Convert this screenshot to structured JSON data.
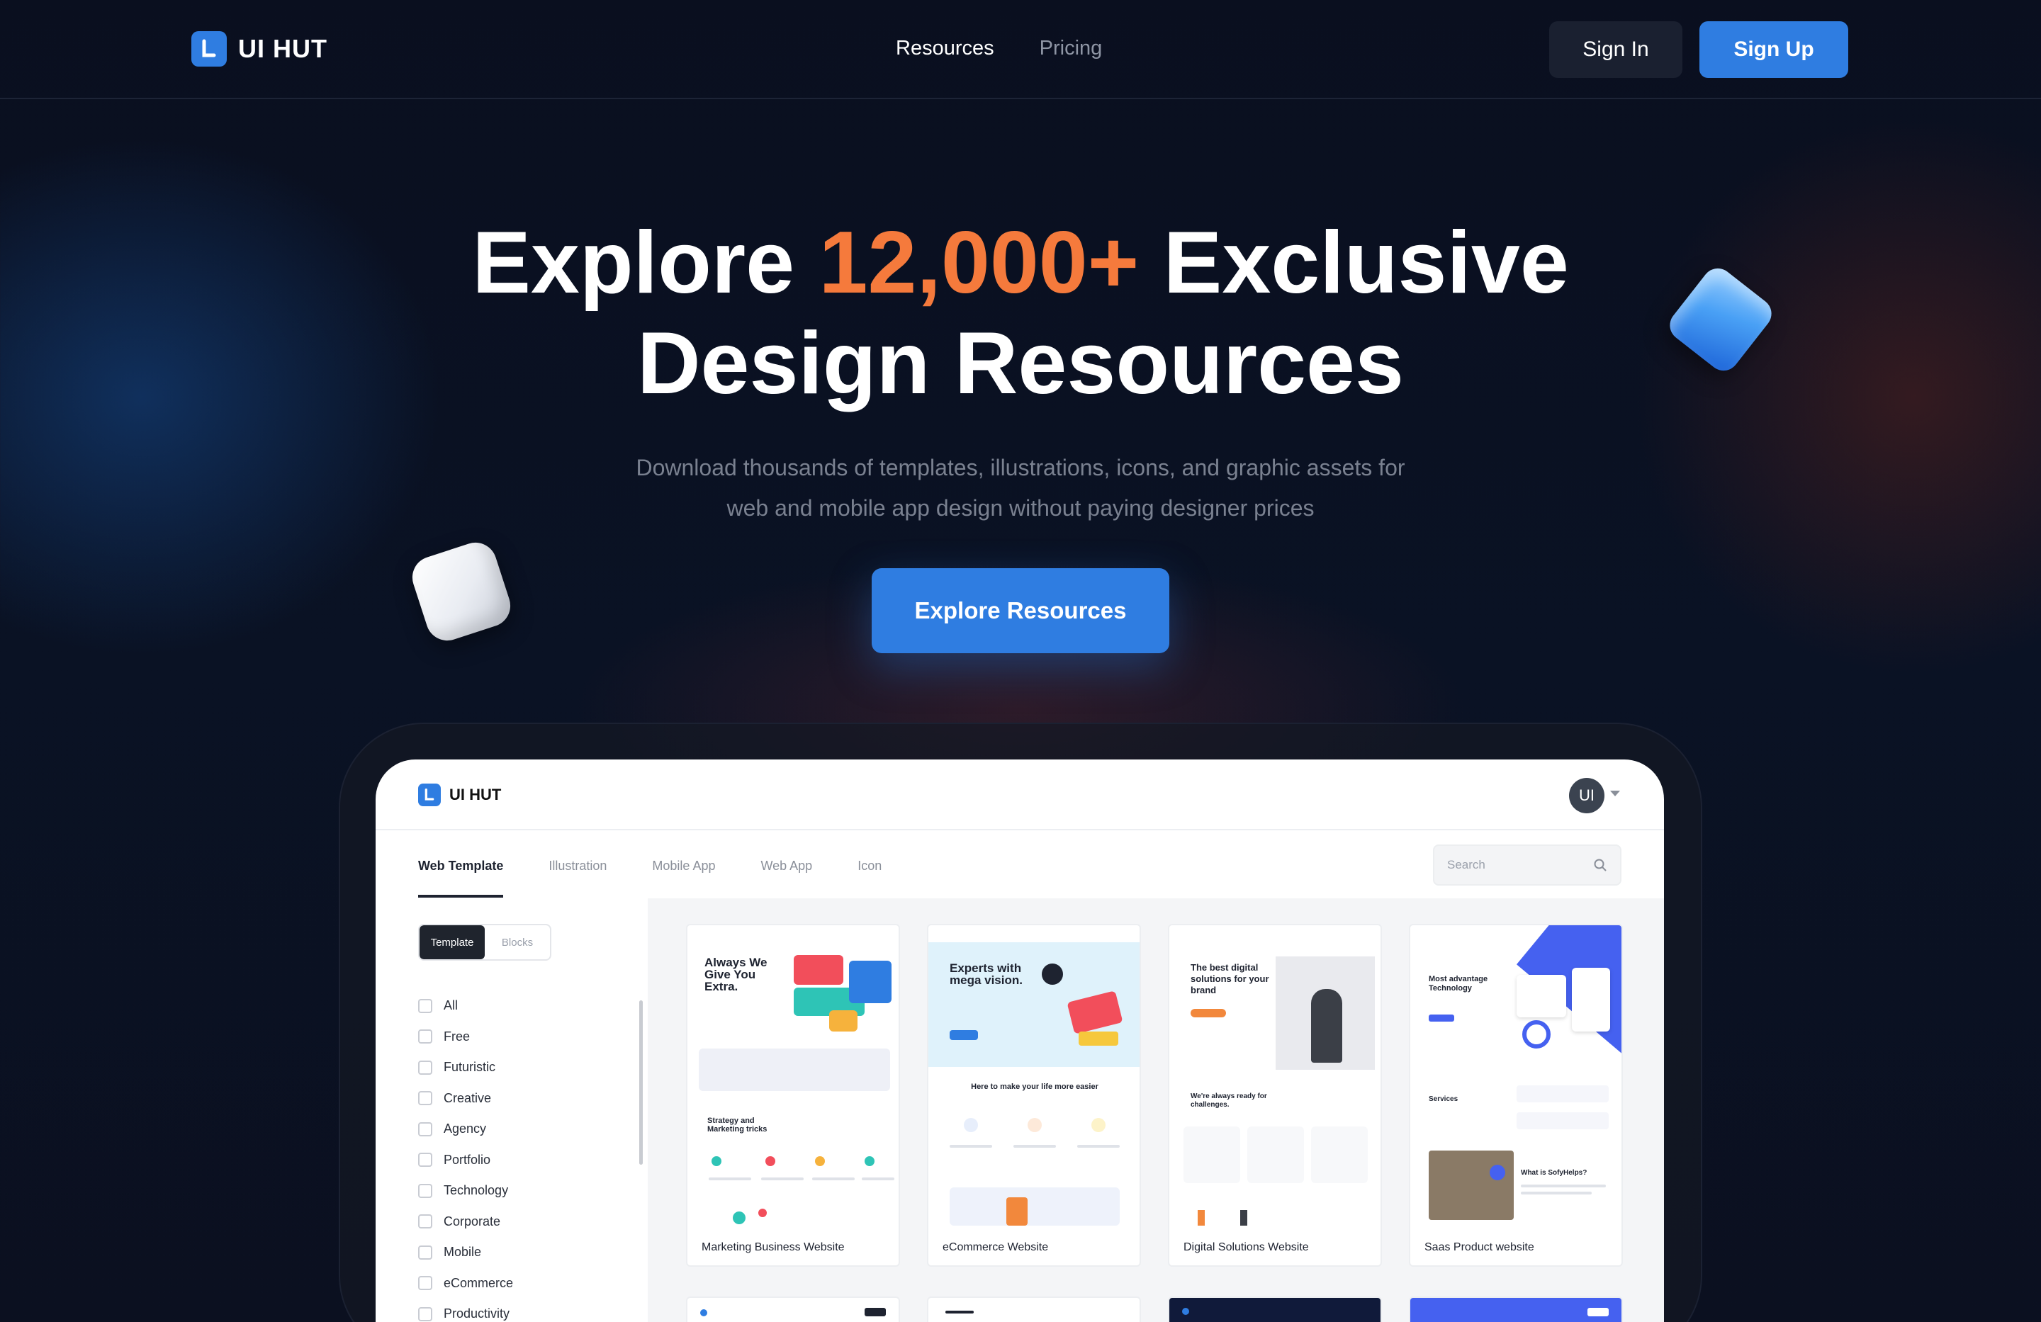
{
  "brand": {
    "name": "UI HUT"
  },
  "nav": {
    "items": [
      "Resources",
      "Pricing"
    ]
  },
  "auth": {
    "sign_in": "Sign In",
    "sign_up": "Sign Up"
  },
  "hero": {
    "title_pre": "Explore ",
    "title_accent": "12,000+",
    "title_post": " Exclusive",
    "title_line2": "Design Resources",
    "subtitle_line1": "Download thousands of templates, illustrations, icons, and graphic assets for",
    "subtitle_line2": "web and mobile app design without paying designer prices",
    "cta": "Explore Resources"
  },
  "app": {
    "brand": "UI HUT",
    "avatar": "UI",
    "tabs": [
      "Web Template",
      "Illustration",
      "Mobile App",
      "Web App",
      "Icon"
    ],
    "search_placeholder": "Search",
    "segment": [
      "Template",
      "Blocks"
    ],
    "categories": [
      "All",
      "Free",
      "Futuristic",
      "Creative",
      "Agency",
      "Portfolio",
      "Technology",
      "Corporate",
      "Mobile",
      "eCommerce",
      "Productivity"
    ],
    "cards": [
      {
        "title": "Marketing Business Website",
        "headline": "Always We Give You Extra.",
        "section": "Strategy and Marketing tricks"
      },
      {
        "title": "eCommerce Website",
        "headline": "Experts with mega vision.",
        "section": "Here to make your life more easier"
      },
      {
        "title": "Digital Solutions Website",
        "headline": "The best digital solutions for your brand",
        "section": "We're always ready for challenges."
      },
      {
        "title": "Saas Product website",
        "headline": "Most advantage Technology",
        "section": "What is SofyHelps?"
      }
    ]
  },
  "colors": {
    "accent": "#f57a3c",
    "primary": "#2f7de1",
    "bg": "#0a1224"
  }
}
